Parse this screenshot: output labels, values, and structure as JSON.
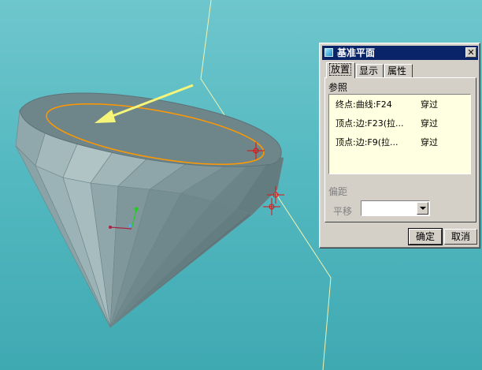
{
  "dialog": {
    "title": "基准平面",
    "close_glyph": "✕",
    "tabs": [
      {
        "label": "放置",
        "active": true
      },
      {
        "label": "显示",
        "active": false
      },
      {
        "label": "属性",
        "active": false
      }
    ],
    "references_label": "参照",
    "references": [
      {
        "name": "终点:曲线:F24",
        "type": "穿过"
      },
      {
        "name": "顶点:边:F23(拉...",
        "type": "穿过"
      },
      {
        "name": "顶点:边:F9(拉...",
        "type": "穿过"
      }
    ],
    "offset_label": "偏距",
    "translation_label": "平移",
    "translation_value": "",
    "ok_label": "确定",
    "cancel_label": "取消"
  },
  "colors": {
    "background": "#55b9c1",
    "model": "#7c969a",
    "selection": "#ff9900",
    "title_bar": "#0a246a",
    "reference_box": "#ffffe1"
  }
}
